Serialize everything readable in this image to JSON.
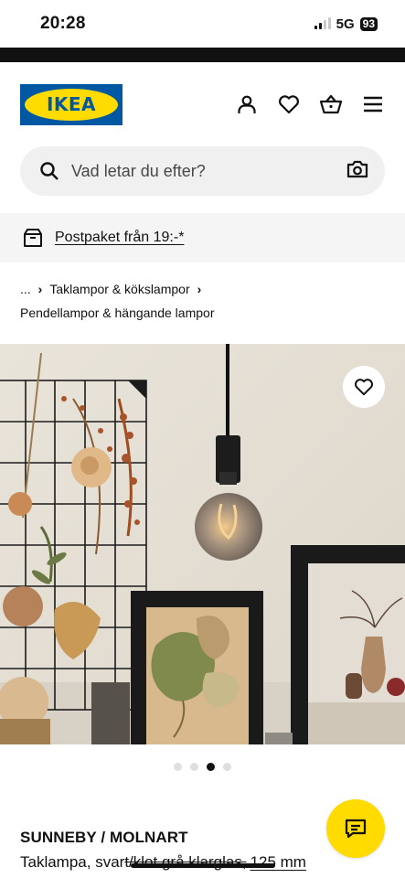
{
  "status_bar": {
    "time": "20:28",
    "network": "5G",
    "battery": "93"
  },
  "header": {
    "logo_text": "IKEA",
    "brand_blue": "#0058a3",
    "brand_yellow": "#ffdb00",
    "icons": [
      "user-icon",
      "heart-icon",
      "basket-icon",
      "menu-icon"
    ]
  },
  "search": {
    "placeholder": "Vad letar du efter?"
  },
  "promo": {
    "text": "Postpaket från 19:-*"
  },
  "breadcrumb": {
    "ellipsis": "...",
    "level1": "Taklampor & kökslampor",
    "current": "Pendellampor & hängande lampor"
  },
  "gallery": {
    "total_images": 4,
    "active_index": 3
  },
  "product": {
    "name": "SUNNEBY / MOLNART",
    "desc_plain": "Taklampa, svar",
    "desc_struck": "t/klot grå klarglas,",
    "size": "125 mm"
  }
}
